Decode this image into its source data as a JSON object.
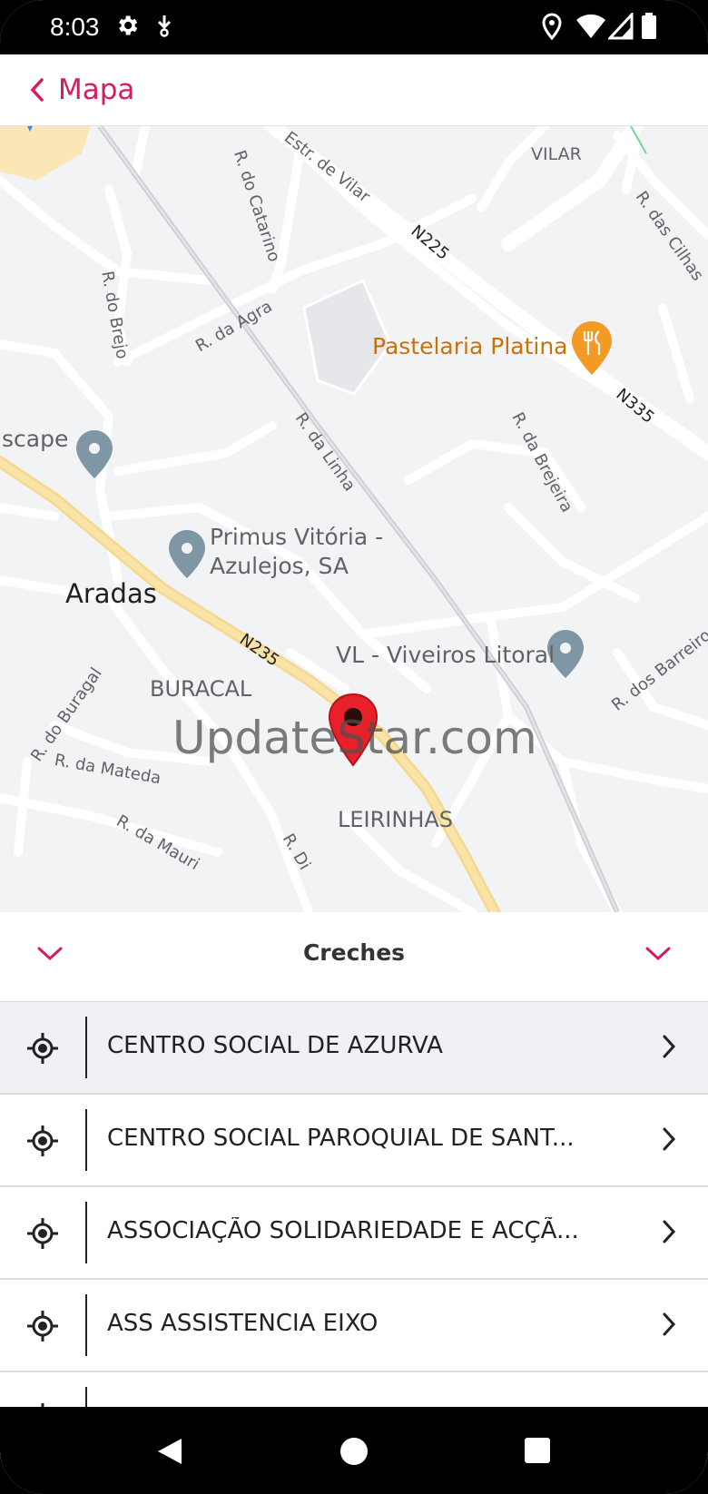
{
  "status_bar": {
    "time": "8:03"
  },
  "app_bar": {
    "back_label": "Mapa",
    "accent": "#d81b60"
  },
  "map": {
    "place_labels": {
      "vilar": "VILAR",
      "aradas": "Aradas",
      "buracal": "BURACAL",
      "leirinhas": "LEIRINHAS"
    },
    "road_labels": {
      "estr_vilar": "Estr. de Vilar",
      "n225": "N225",
      "n335": "N335",
      "n235": "N235",
      "r_catarino": "R. do Catarino",
      "r_cilhas": "R. das Cilhas",
      "r_brejo": "R. do Brejo",
      "r_agra": "R. da Agra",
      "r_linha": "R. da Linha",
      "r_brejeira": "R. da Brejeira",
      "r_barreiros": "R. dos Barreiros",
      "r_buragal": "R. do Buragal",
      "r_mateda": "R. da Mateda",
      "r_mauri": "R. da Mauri",
      "r_di": "R. Di"
    },
    "pois": {
      "pastelaria": "Pastelaria Platina",
      "escape": "scape",
      "primus_line1": "Primus Vitória -",
      "primus_line2": "Azulejos, SA",
      "viveiros": "VL - Viveiros Litoral"
    },
    "watermark": "UpdateStar.com"
  },
  "sheet": {
    "title": "Creches",
    "items": [
      {
        "label": "CENTRO SOCIAL DE AZURVA"
      },
      {
        "label": "CENTRO SOCIAL PAROQUIAL DE SANT..."
      },
      {
        "label": "ASSOCIAÇÃO SOLIDARIEDADE E ACÇÃ..."
      },
      {
        "label": "ASS ASSISTENCIA EIXO"
      }
    ]
  }
}
